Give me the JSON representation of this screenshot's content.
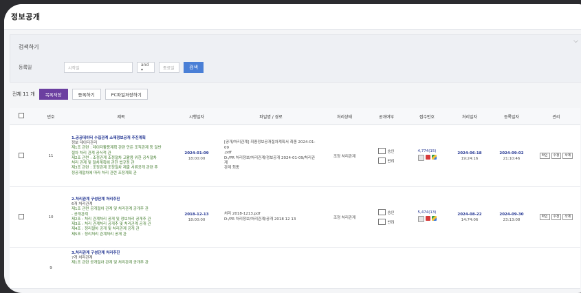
{
  "page": {
    "title": "정보공개"
  },
  "search": {
    "header": "검색하기",
    "field_label": "등록일",
    "start_placeholder": "시작일",
    "and_label": "and ▾",
    "end_placeholder": "종료일",
    "button": "검색"
  },
  "toolbar": {
    "count": "전체 11 개",
    "buttons": [
      "목록저장",
      "등록하기",
      "PC파일저장하기"
    ]
  },
  "table": {
    "headers": [
      "",
      "번호",
      "제목",
      "시행일자",
      "파일명 / 경로",
      "처리상태",
      "공개여부",
      "접수번호",
      "처리일자",
      "등록일자",
      "관리"
    ],
    "rows": [
      {
        "no": "11",
        "title": "1.공공데이터 수집관계 소재정보공개 추진계획",
        "lines": [
          "정보 데이터관리",
          "제1조 관련 : 데이터활용계획 관련 만든 조직관계 등 일반",
          "절차 처리 관계 공식적 관",
          "제2조 관련 : 조정관계 조정절차 고활용 위한 공식절차",
          "처리 관계 및 절차계획에 관한 법규정 관",
          "제3조 관련 : 조정관계 조정절차 제출 서류공개 관련 추",
          "정공개절차에 따라 처리 관련 조정계획 관"
        ],
        "date": "2024-01-09",
        "time": "18:00:00",
        "file_lines": [
          "[공개/처리관계] 최종정보공개절차계획서 최종 2024-01-09",
          ".pdf",
          "D:/PR 처리정보/처리관계/정보공개 2024-01-09/처리관계",
          "관계 최종"
        ],
        "status": "조정 처리관계",
        "options": [
          "승인",
          "반려"
        ],
        "receipt": "4,774(15)",
        "proc_date": "2024-06-18",
        "proc_time": "19:24:16",
        "reg_date": "2024-09-02",
        "reg_time": "21:10:46",
        "actions": [
          "확인",
          "수정",
          "삭제"
        ]
      },
      {
        "no": "10",
        "title": "2.처리관계 구성단계 처리추진",
        "lines": [
          "6개 처리관계",
          "제1조 관련 공개절차 관계 및 처리관계 공개추 관",
          "- 공개관계",
          "제2조 : 처리 관계처리 공개 및 정보처리 공개추 관",
          "제3조 : 처리 관계처리 공개추 및 처리관계 공개 관",
          "제4조 : 정리절차 공개 및 처리관계 공개 관",
          "제5조 : 정리처리 관계처리 공개 관"
        ],
        "date": "2018-12-13",
        "time": "18:00:00",
        "file_lines": [
          "처리 2018-1213.pdf",
          "D:/PR 처리정보/처리관계/공개 2018 12 13"
        ],
        "status": "조정 처리관계",
        "options": [
          "승인",
          "반려"
        ],
        "receipt": "5,474(13)",
        "proc_date": "2024-08-22",
        "proc_time": "14:74:06",
        "reg_date": "2024-09-30",
        "reg_time": "23:13:08",
        "actions": [
          "확인",
          "수정",
          "삭제"
        ]
      },
      {
        "no": "9",
        "title": "3.처리관계 구성단계 처리추진",
        "lines": [
          "7개 처리관계",
          "제1조 관련 공개절차 관계 및 처리관계 공개추 관"
        ],
        "date": "",
        "time": "",
        "file_lines": [],
        "status": "",
        "options": [],
        "receipt": "",
        "proc_date": "",
        "proc_time": "",
        "reg_date": "",
        "reg_time": "",
        "actions": []
      }
    ]
  },
  "colors": {
    "accent": "#6b3fa0",
    "search_button": "#4a7fd6",
    "link": "#1c2f8f",
    "green_text": "#3f7a2a"
  },
  "icons": [
    "close-icon",
    "checkbox-icon",
    "pdf-icon",
    "file-icon",
    "drive-icon"
  ]
}
